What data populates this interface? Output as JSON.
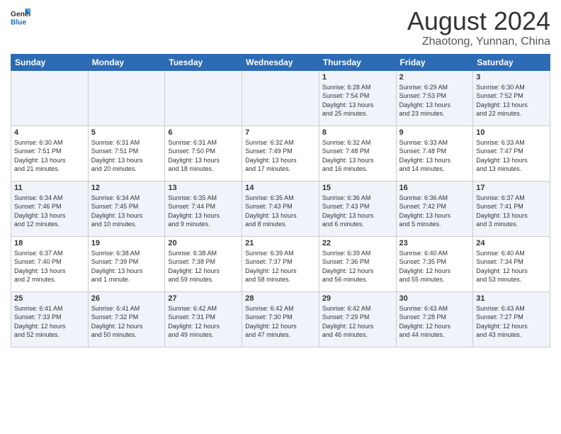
{
  "header": {
    "logo_line1": "General",
    "logo_line2": "Blue",
    "title": "August 2024",
    "subtitle": "Zhaotong, Yunnan, China"
  },
  "weekdays": [
    "Sunday",
    "Monday",
    "Tuesday",
    "Wednesday",
    "Thursday",
    "Friday",
    "Saturday"
  ],
  "weeks": [
    [
      {
        "day": "",
        "info": ""
      },
      {
        "day": "",
        "info": ""
      },
      {
        "day": "",
        "info": ""
      },
      {
        "day": "",
        "info": ""
      },
      {
        "day": "1",
        "info": "Sunrise: 6:28 AM\nSunset: 7:54 PM\nDaylight: 13 hours\nand 25 minutes."
      },
      {
        "day": "2",
        "info": "Sunrise: 6:29 AM\nSunset: 7:53 PM\nDaylight: 13 hours\nand 23 minutes."
      },
      {
        "day": "3",
        "info": "Sunrise: 6:30 AM\nSunset: 7:52 PM\nDaylight: 13 hours\nand 22 minutes."
      }
    ],
    [
      {
        "day": "4",
        "info": "Sunrise: 6:30 AM\nSunset: 7:51 PM\nDaylight: 13 hours\nand 21 minutes."
      },
      {
        "day": "5",
        "info": "Sunrise: 6:31 AM\nSunset: 7:51 PM\nDaylight: 13 hours\nand 20 minutes."
      },
      {
        "day": "6",
        "info": "Sunrise: 6:31 AM\nSunset: 7:50 PM\nDaylight: 13 hours\nand 18 minutes."
      },
      {
        "day": "7",
        "info": "Sunrise: 6:32 AM\nSunset: 7:49 PM\nDaylight: 13 hours\nand 17 minutes."
      },
      {
        "day": "8",
        "info": "Sunrise: 6:32 AM\nSunset: 7:48 PM\nDaylight: 13 hours\nand 16 minutes."
      },
      {
        "day": "9",
        "info": "Sunrise: 6:33 AM\nSunset: 7:48 PM\nDaylight: 13 hours\nand 14 minutes."
      },
      {
        "day": "10",
        "info": "Sunrise: 6:33 AM\nSunset: 7:47 PM\nDaylight: 13 hours\nand 13 minutes."
      }
    ],
    [
      {
        "day": "11",
        "info": "Sunrise: 6:34 AM\nSunset: 7:46 PM\nDaylight: 13 hours\nand 12 minutes."
      },
      {
        "day": "12",
        "info": "Sunrise: 6:34 AM\nSunset: 7:45 PM\nDaylight: 13 hours\nand 10 minutes."
      },
      {
        "day": "13",
        "info": "Sunrise: 6:35 AM\nSunset: 7:44 PM\nDaylight: 13 hours\nand 9 minutes."
      },
      {
        "day": "14",
        "info": "Sunrise: 6:35 AM\nSunset: 7:43 PM\nDaylight: 13 hours\nand 8 minutes."
      },
      {
        "day": "15",
        "info": "Sunrise: 6:36 AM\nSunset: 7:43 PM\nDaylight: 13 hours\nand 6 minutes."
      },
      {
        "day": "16",
        "info": "Sunrise: 6:36 AM\nSunset: 7:42 PM\nDaylight: 13 hours\nand 5 minutes."
      },
      {
        "day": "17",
        "info": "Sunrise: 6:37 AM\nSunset: 7:41 PM\nDaylight: 13 hours\nand 3 minutes."
      }
    ],
    [
      {
        "day": "18",
        "info": "Sunrise: 6:37 AM\nSunset: 7:40 PM\nDaylight: 13 hours\nand 2 minutes."
      },
      {
        "day": "19",
        "info": "Sunrise: 6:38 AM\nSunset: 7:39 PM\nDaylight: 13 hours\nand 1 minute."
      },
      {
        "day": "20",
        "info": "Sunrise: 6:38 AM\nSunset: 7:38 PM\nDaylight: 12 hours\nand 59 minutes."
      },
      {
        "day": "21",
        "info": "Sunrise: 6:39 AM\nSunset: 7:37 PM\nDaylight: 12 hours\nand 58 minutes."
      },
      {
        "day": "22",
        "info": "Sunrise: 6:39 AM\nSunset: 7:36 PM\nDaylight: 12 hours\nand 56 minutes."
      },
      {
        "day": "23",
        "info": "Sunrise: 6:40 AM\nSunset: 7:35 PM\nDaylight: 12 hours\nand 55 minutes."
      },
      {
        "day": "24",
        "info": "Sunrise: 6:40 AM\nSunset: 7:34 PM\nDaylight: 12 hours\nand 53 minutes."
      }
    ],
    [
      {
        "day": "25",
        "info": "Sunrise: 6:41 AM\nSunset: 7:33 PM\nDaylight: 12 hours\nand 52 minutes."
      },
      {
        "day": "26",
        "info": "Sunrise: 6:41 AM\nSunset: 7:32 PM\nDaylight: 12 hours\nand 50 minutes."
      },
      {
        "day": "27",
        "info": "Sunrise: 6:42 AM\nSunset: 7:31 PM\nDaylight: 12 hours\nand 49 minutes."
      },
      {
        "day": "28",
        "info": "Sunrise: 6:42 AM\nSunset: 7:30 PM\nDaylight: 12 hours\nand 47 minutes."
      },
      {
        "day": "29",
        "info": "Sunrise: 6:42 AM\nSunset: 7:29 PM\nDaylight: 12 hours\nand 46 minutes."
      },
      {
        "day": "30",
        "info": "Sunrise: 6:43 AM\nSunset: 7:28 PM\nDaylight: 12 hours\nand 44 minutes."
      },
      {
        "day": "31",
        "info": "Sunrise: 6:43 AM\nSunset: 7:27 PM\nDaylight: 12 hours\nand 43 minutes."
      }
    ]
  ]
}
